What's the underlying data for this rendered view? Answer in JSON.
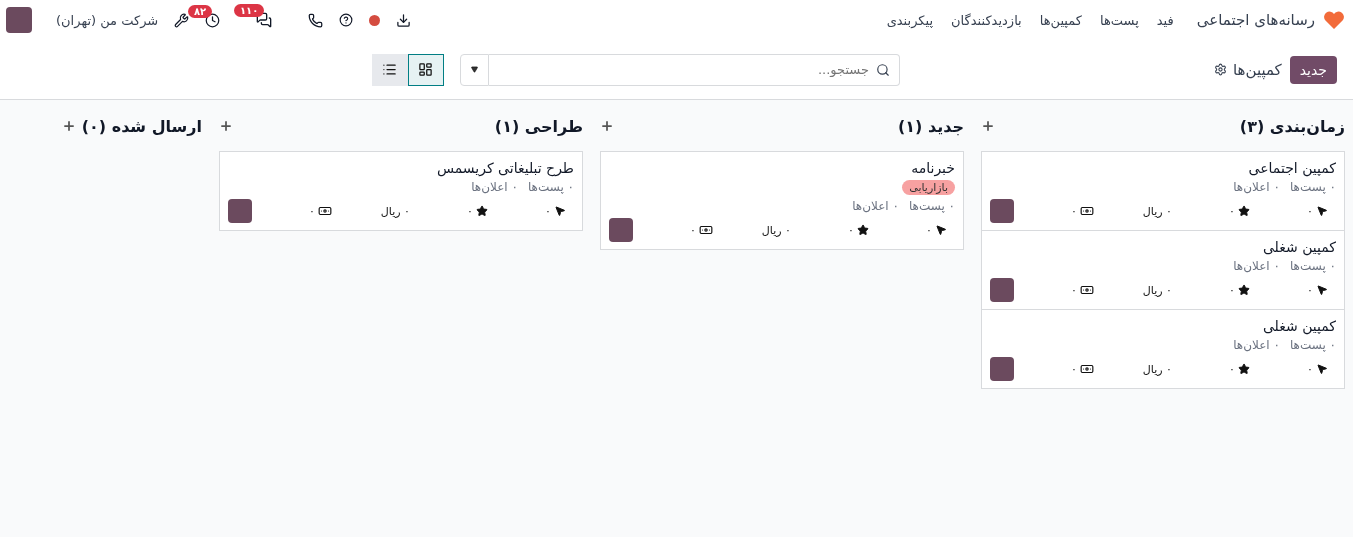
{
  "navbar": {
    "app_name": "رسانه‌های اجتماعی",
    "menu": [
      "فید",
      "پست‌ها",
      "کمپین‌ها",
      "بازدیدکنندگان",
      "پیکربندی"
    ],
    "chat_badge": "۱۱۰",
    "activity_badge": "۸۲",
    "company": "شرکت من (تهران)"
  },
  "control_panel": {
    "new_button": "جدید",
    "breadcrumb": "کمپین‌ها",
    "search": {
      "placeholder": "جستجو..."
    },
    "views": [
      {
        "kind": "kanban",
        "selected": true
      },
      {
        "kind": "list",
        "selected": false
      }
    ]
  },
  "columns": [
    {
      "title": "زمان‌بندی (۳)",
      "cards": [
        {
          "name": "کمپین اجتماعی",
          "posts": "۰ پست‌ها",
          "notifications": "۰ اعلان‌ها",
          "clicks": "۰",
          "favorites": "۰",
          "revenue": "۰ ریال",
          "cost": "۰"
        },
        {
          "name": "کمپین شغلی",
          "posts": "۰ پست‌ها",
          "notifications": "۰ اعلان‌ها",
          "clicks": "۰",
          "favorites": "۰",
          "revenue": "۰ ریال",
          "cost": "۰"
        },
        {
          "name": "کمپین شغلی",
          "posts": "۰ پست‌ها",
          "notifications": "۰ اعلان‌ها",
          "clicks": "۰",
          "favorites": "۰",
          "revenue": "۰ ریال",
          "cost": "۰"
        }
      ]
    },
    {
      "title": "جدید (۱)",
      "cards": [
        {
          "name": "خبرنامه",
          "tags": [
            {
              "label": "بازاریابی",
              "color": "#f7a1a1"
            }
          ],
          "posts": "۰ پست‌ها",
          "notifications": "۰ اعلان‌ها",
          "clicks": "۰",
          "favorites": "۰",
          "revenue": "۰ ریال",
          "cost": "۰"
        }
      ]
    },
    {
      "title": "طراحی (۱)",
      "cards": [
        {
          "name": "طرح تبلیغاتی کریسمس",
          "posts": "۰ پست‌ها",
          "notifications": "۰ اعلان‌ها",
          "clicks": "۰",
          "favorites": "۰",
          "revenue": "۰ ریال",
          "cost": "۰"
        }
      ]
    },
    {
      "title": "ارسال شده (۰)"
    }
  ]
}
